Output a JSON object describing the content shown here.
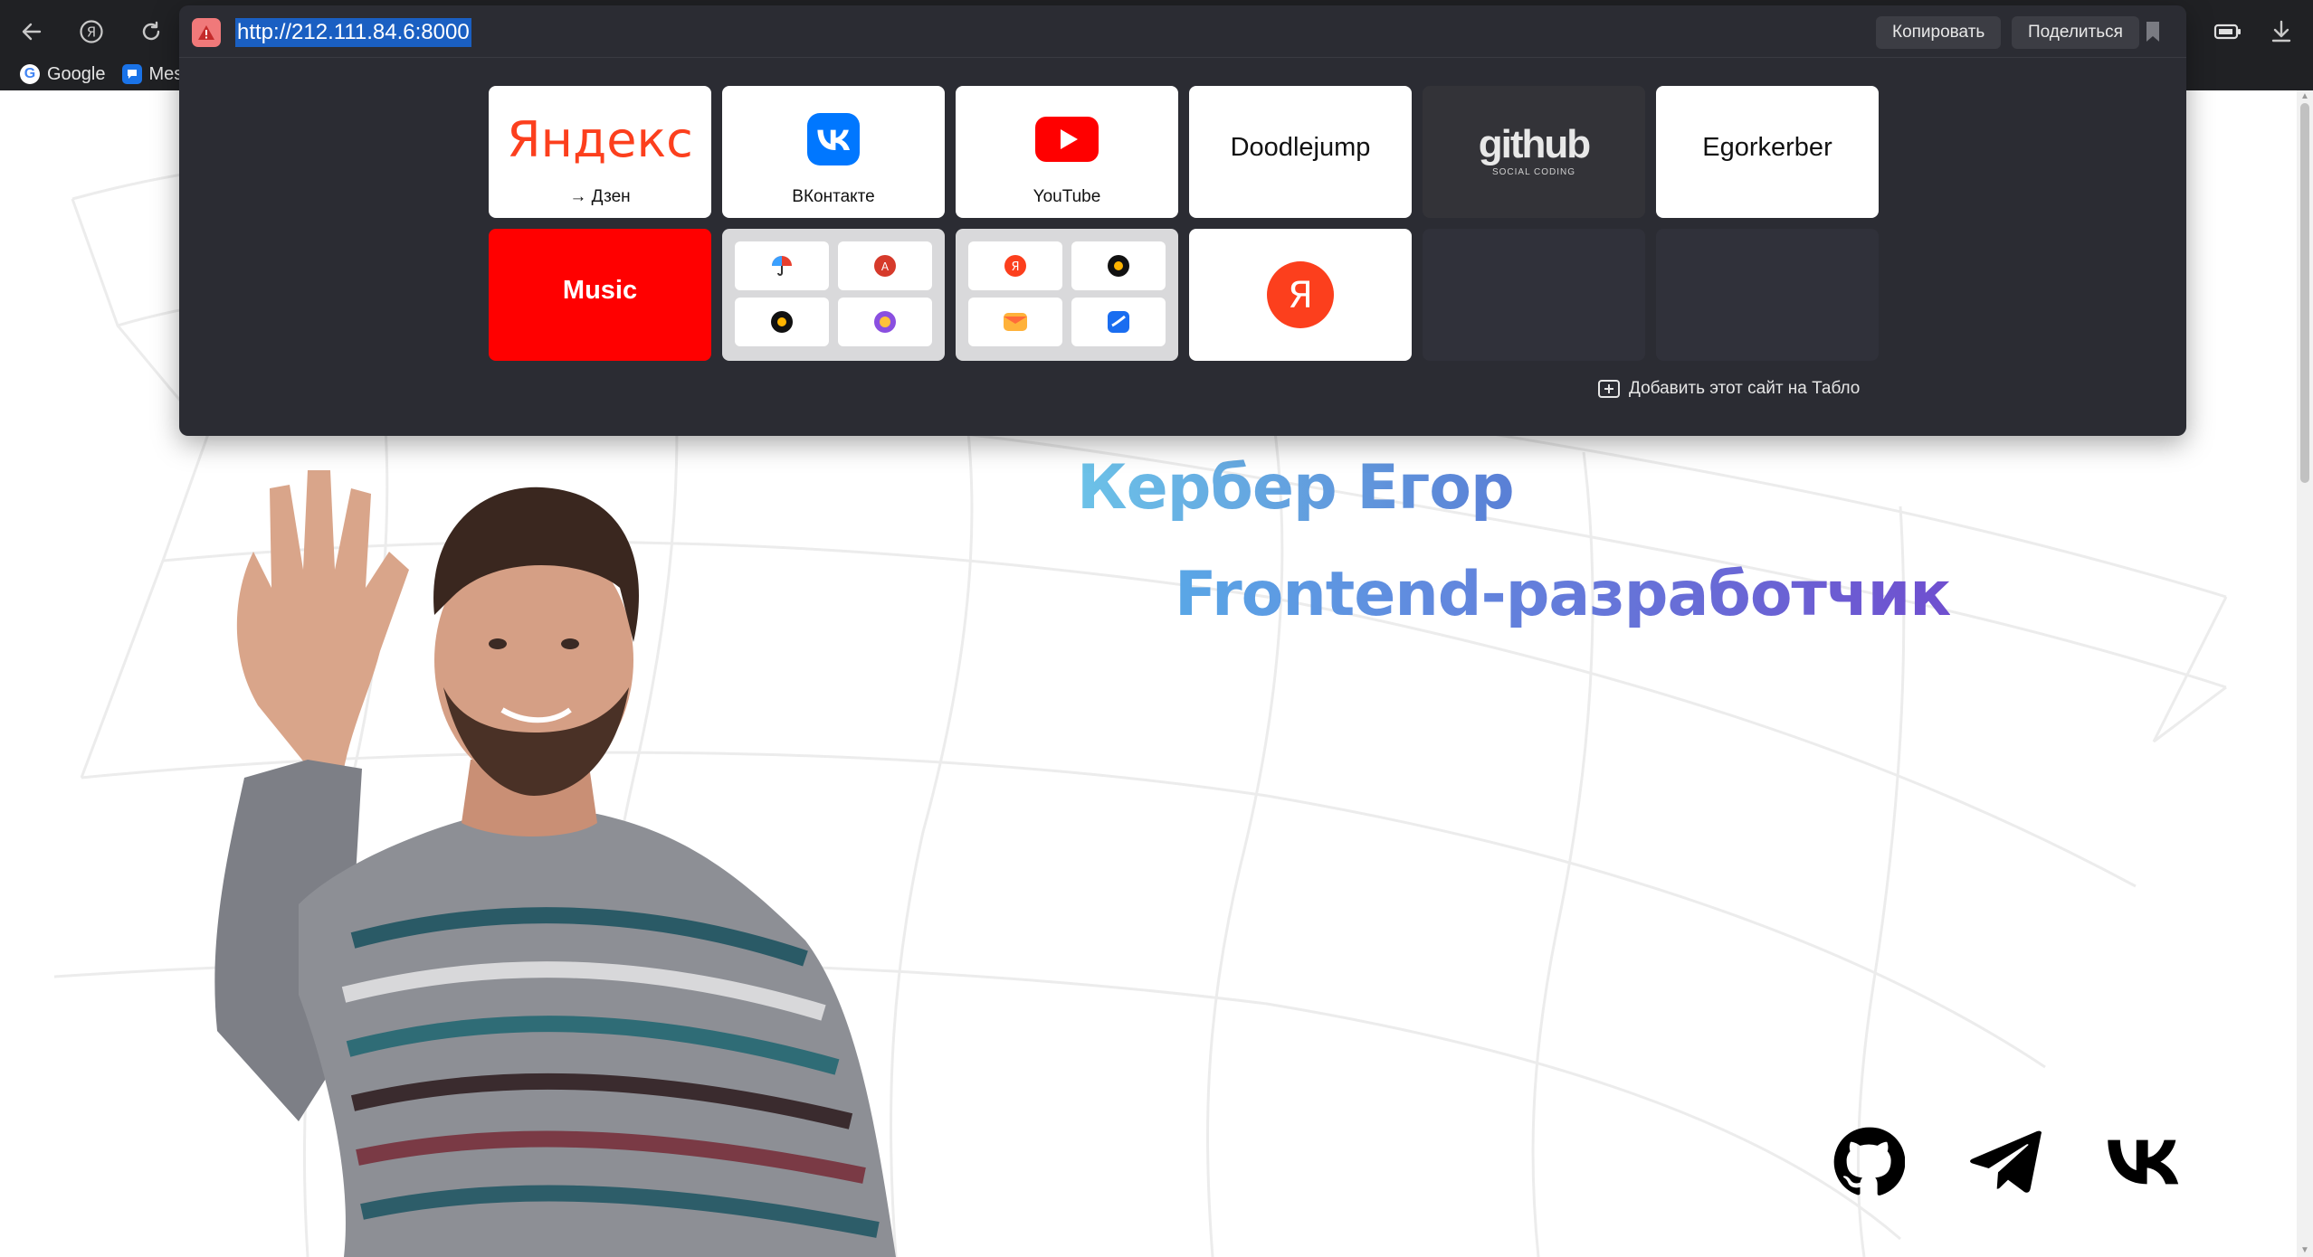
{
  "browser": {
    "url": "http://212.111.84.6:8000",
    "copy_button": "Копировать",
    "share_button": "Поделиться",
    "bookmarks": [
      {
        "label": "Google",
        "icon": "google-icon"
      },
      {
        "label": "Mes",
        "icon": "messenger-icon"
      }
    ]
  },
  "tablo": {
    "tiles": [
      {
        "title": "Яндекс",
        "subtitle": "→ Дзен"
      },
      {
        "title": "",
        "subtitle": "ВКонтакте"
      },
      {
        "title": "",
        "subtitle": "YouTube"
      },
      {
        "title": "Doodlejump",
        "subtitle": ""
      },
      {
        "title": "github",
        "subtitle": "SOCIAL CODING"
      },
      {
        "title": "Egorkerber",
        "subtitle": ""
      },
      {
        "title": "Music",
        "subtitle": ""
      }
    ],
    "add_site": "Добавить этот сайт на Табло"
  },
  "profile": {
    "name": "Кербер Егор",
    "role": "Frontend-разработчик"
  },
  "social": [
    "github-icon",
    "telegram-icon",
    "vk-icon"
  ],
  "colors": {
    "chrome_bg": "#202124",
    "tablo_bg": "#2b2c33",
    "music_red": "#ff0000",
    "yandex_red": "#fc3f1d",
    "vk_blue": "#0077ff",
    "url_selection": "#1a5fc2"
  }
}
